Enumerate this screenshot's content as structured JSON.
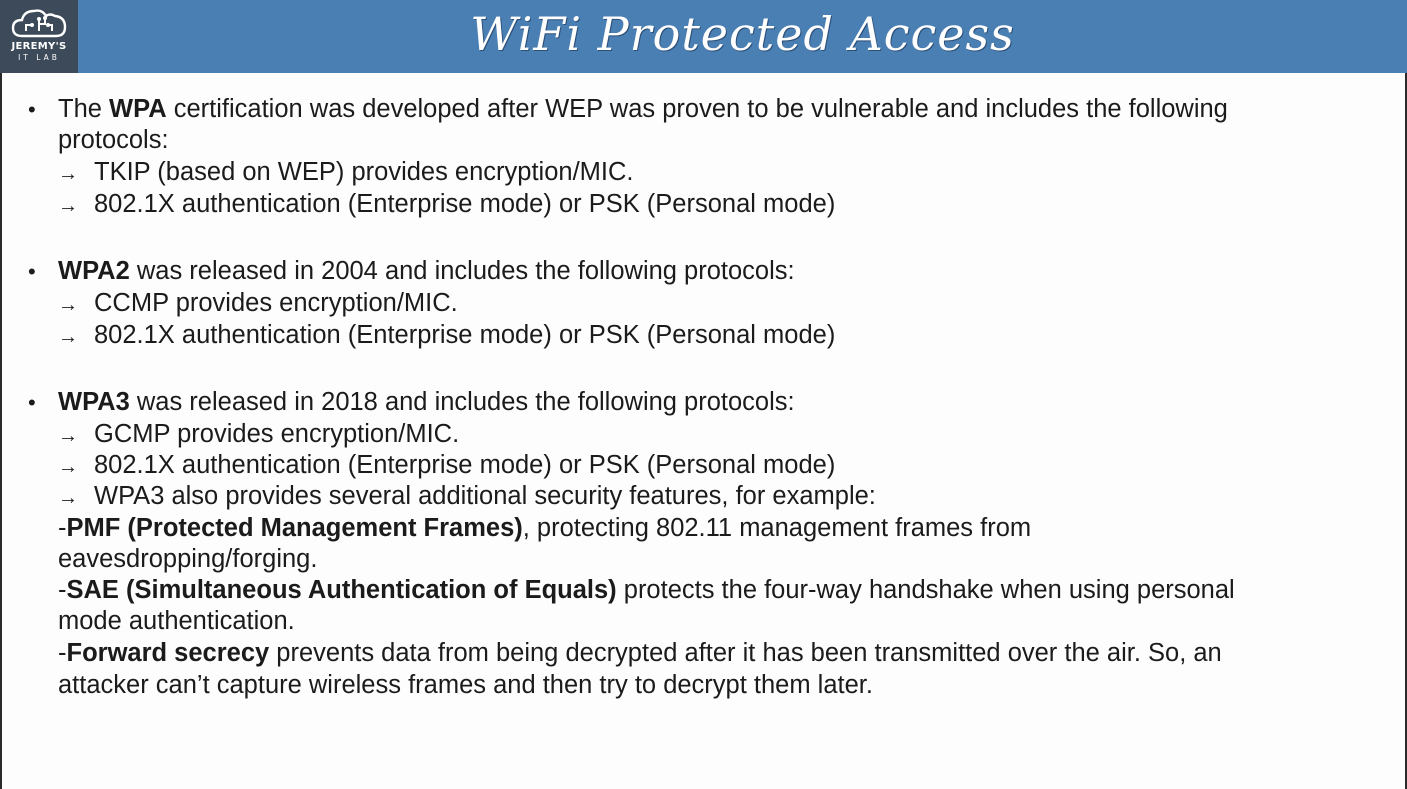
{
  "header": {
    "title": "WiFi Protected Access",
    "logo_line1": "JEREMY'S",
    "logo_line2": "IT LAB"
  },
  "sections": {
    "wpa": {
      "term": "WPA",
      "pre": "The ",
      "line1_rest": " certification was developed after WEP was proven to be vulnerable and includes the following",
      "line2": "protocols:",
      "items": [
        "TKIP (based on WEP) provides encryption/MIC.",
        "802.1X authentication (Enterprise mode) or PSK (Personal mode)"
      ]
    },
    "wpa2": {
      "term": "WPA2",
      "rest": " was released in 2004 and includes the following protocols:",
      "items": [
        "CCMP provides encryption/MIC.",
        "802.1X authentication (Enterprise mode) or PSK (Personal mode)"
      ]
    },
    "wpa3": {
      "term": "WPA3",
      "rest": " was released in 2018 and includes the following protocols:",
      "items": [
        "GCMP provides encryption/MIC.",
        "802.1X authentication (Enterprise mode) or PSK (Personal mode)",
        "WPA3 also provides several additional security features, for example:"
      ],
      "features": {
        "pmf_term": "PMF (Protected Management Frames)",
        "pmf_rest": ", protecting 802.11 management frames from",
        "pmf_line2": "eavesdropping/forging.",
        "sae_term": "SAE (Simultaneous Authentication of Equals)",
        "sae_rest": " protects the four-way handshake when using personal",
        "sae_line2": "mode authentication.",
        "fs_term": "Forward secrecy",
        "fs_rest": " prevents data from being decrypted after it has been transmitted over the air.  So, an",
        "fs_line2": "attacker can’t capture wireless frames and then try to decrypt them later."
      }
    }
  },
  "symbols": {
    "bullet": "•",
    "arrow": "→",
    "dash": "-"
  }
}
